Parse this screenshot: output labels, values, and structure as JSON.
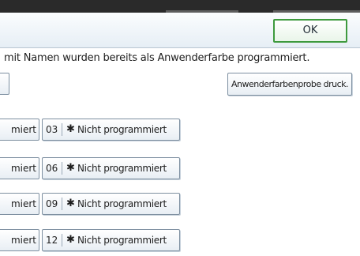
{
  "header": {
    "ok_label": "OK"
  },
  "message": "mit Namen wurden bereits als Anwenderfarbe programmiert.",
  "print_button_label": "Anwenderfarbenprobe druck.",
  "rows": [
    {
      "left_label": "miert",
      "number": "03",
      "marker": "✱",
      "status": "Nicht programmiert"
    },
    {
      "left_label": "miert",
      "number": "06",
      "marker": "✱",
      "status": "Nicht programmiert"
    },
    {
      "left_label": "miert",
      "number": "09",
      "marker": "✱",
      "status": "Nicht programmiert"
    },
    {
      "left_label": "miert",
      "number": "12",
      "marker": "✱",
      "status": "Nicht programmiert"
    }
  ],
  "colors": {
    "ok_border": "#3e9a3e",
    "button_border": "#7d8fa0",
    "top_bar": "#2a2a2a"
  }
}
